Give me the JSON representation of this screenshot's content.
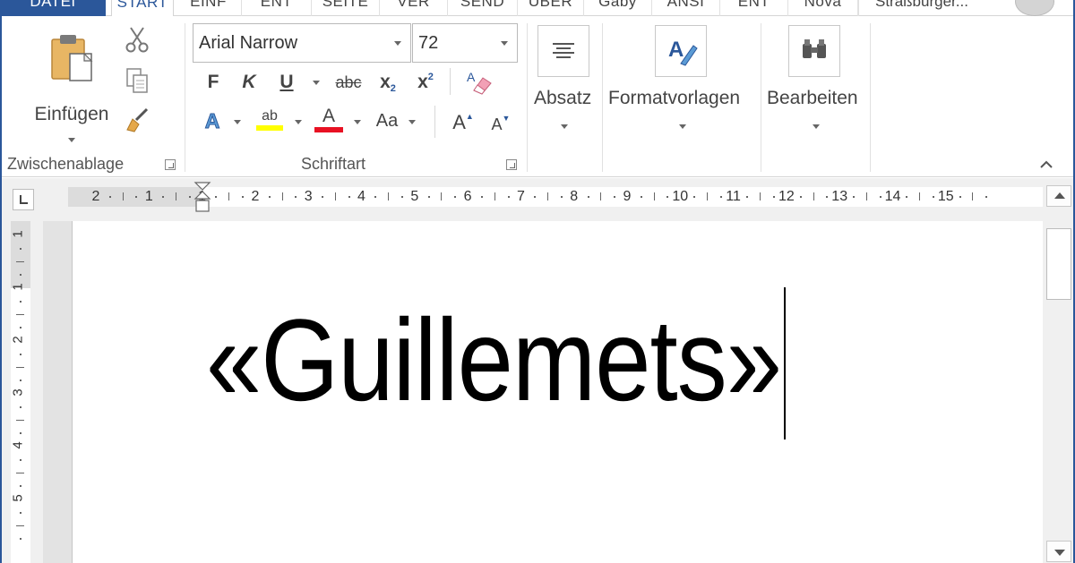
{
  "tabs": [
    {
      "label": "DATEI"
    },
    {
      "label": "START"
    },
    {
      "label": "EINF"
    },
    {
      "label": "ENT"
    },
    {
      "label": "SEITE"
    },
    {
      "label": "VER"
    },
    {
      "label": "SEND"
    },
    {
      "label": "ÜBER"
    },
    {
      "label": "Gaby"
    },
    {
      "label": "ANSI"
    },
    {
      "label": "ENT"
    },
    {
      "label": "Nova"
    }
  ],
  "user_name": "Straßburger...",
  "clipboard": {
    "paste_label": "Einfügen",
    "group_label": "Zwischenablage"
  },
  "font": {
    "font_name": "Arial Narrow",
    "font_size": "72",
    "bold_label": "F",
    "italic_label": "K",
    "underline_label": "U",
    "strike_label": "abc",
    "subscript_label": "x",
    "superscript_label": "x",
    "sub_index": "2",
    "sup_index": "2",
    "text_effects_label": "A",
    "highlight_label": "ab",
    "font_color_label": "A",
    "change_case_label": "Aa",
    "grow_label": "A",
    "shrink_label": "A",
    "group_label": "Schriftart",
    "highlight_color": "#ffff00",
    "font_color": "#e81123"
  },
  "paragraph": {
    "label": "Absatz"
  },
  "styles": {
    "label": "Formatvorlagen"
  },
  "editing": {
    "label": "Bearbeiten"
  },
  "ruler_h": [
    "2",
    "1",
    "1",
    "2",
    "3",
    "4",
    "5",
    "6",
    "7",
    "8",
    "9",
    "10",
    "11",
    "12",
    "13",
    "14",
    "15"
  ],
  "ruler_v": [
    "1",
    "1",
    "2",
    "3",
    "4",
    "5"
  ],
  "document": {
    "text": "«Guillemets»"
  },
  "colors": {
    "accent": "#2b579a",
    "ribbon_bg": "#ffffff",
    "ruler_bg": "#f0f0f0"
  }
}
